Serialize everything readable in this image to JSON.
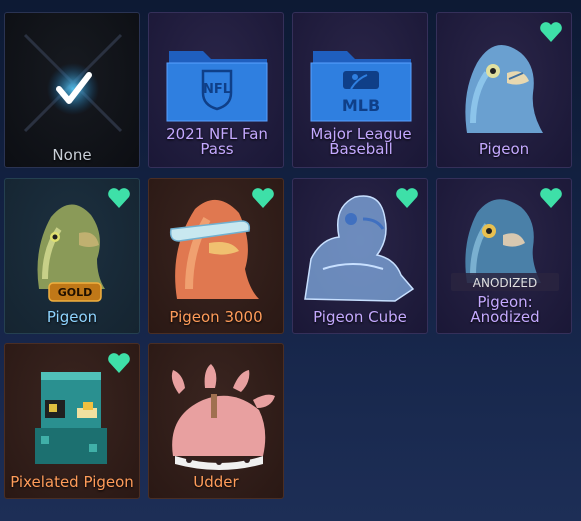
{
  "items": [
    {
      "label": "None",
      "icon": "none-checkmark-icon",
      "favorite": false
    },
    {
      "label": "2021 NFL Fan Pass",
      "icon": "nfl-folder-icon",
      "folder_text": "NFL",
      "favorite": false
    },
    {
      "label": "Major League Baseball",
      "icon": "mlb-folder-icon",
      "folder_text": "MLB",
      "favorite": false
    },
    {
      "label": "Pigeon",
      "icon": "pigeon-topper-icon",
      "favorite": true
    },
    {
      "label": "Pigeon",
      "icon": "gold-pigeon-topper-icon",
      "badge": "GOLD",
      "favorite": true
    },
    {
      "label": "Pigeon 3000",
      "icon": "pigeon-3000-topper-icon",
      "favorite": true
    },
    {
      "label": "Pigeon Cube",
      "icon": "pigeon-cube-topper-icon",
      "favorite": true
    },
    {
      "label": "Pigeon: Anodized",
      "icon": "anodized-pigeon-topper-icon",
      "badge": "ANODIZED",
      "favorite": true
    },
    {
      "label": "Pixelated Pigeon",
      "icon": "pixelated-pigeon-topper-icon",
      "favorite": true
    },
    {
      "label": "Udder",
      "icon": "udder-topper-icon",
      "favorite": false
    }
  ],
  "colors": {
    "favorite": "#3ee0a8",
    "folder": "#2f7fe0",
    "rarity_default": "#c9cfd8",
    "rarity_purple": "#c4a9ff",
    "rarity_blue": "#8fd4ff",
    "rarity_orange": "#ff9c5a"
  }
}
